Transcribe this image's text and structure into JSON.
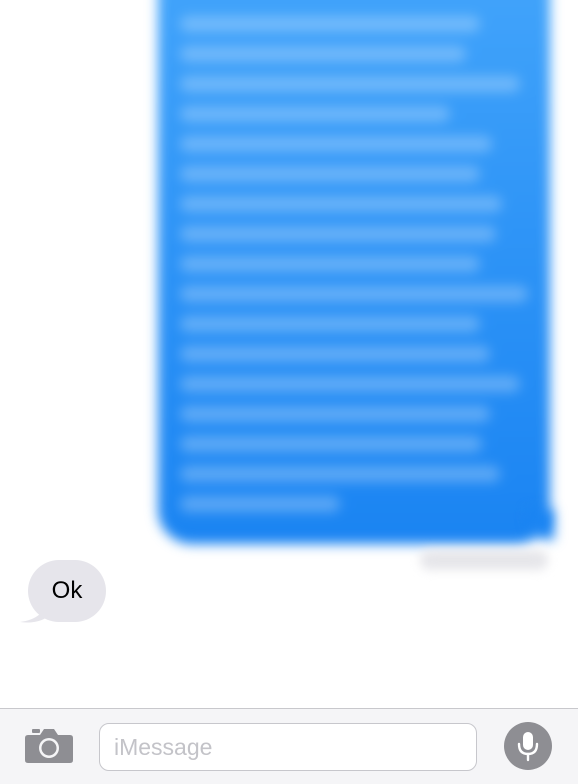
{
  "conversation": {
    "incoming_message": {
      "text": "Ok"
    }
  },
  "composer": {
    "placeholder": "iMessage",
    "value": ""
  },
  "icons": {
    "camera": "camera-icon",
    "microphone": "microphone-icon"
  },
  "colors": {
    "outgoing_bubble": "#2f95f7",
    "incoming_bubble": "#e6e5eb",
    "mic_button": "#8e8e93",
    "camera_icon": "#8e8e93"
  }
}
